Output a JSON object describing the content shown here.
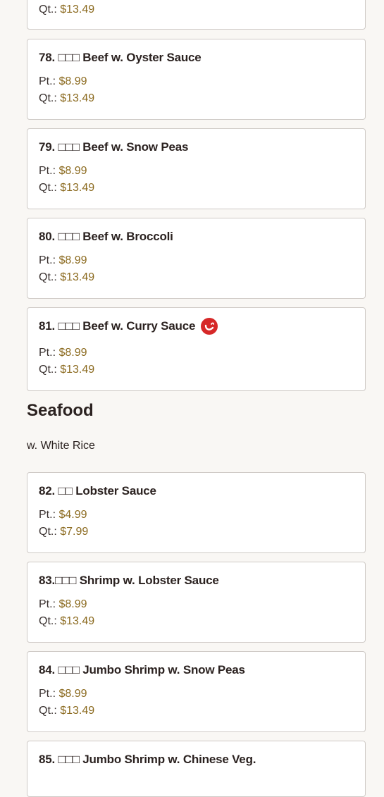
{
  "top_partial": {
    "qt_label": "Qt.:",
    "qt_price": "$13.49"
  },
  "items": [
    {
      "title": "78. □□□ Beef w. Oyster Sauce",
      "pt_label": "Pt.:",
      "pt_price": "$8.99",
      "qt_label": "Qt.:",
      "qt_price": "$13.49"
    },
    {
      "title": "79. □□□ Beef w. Snow Peas",
      "pt_label": "Pt.:",
      "pt_price": "$8.99",
      "qt_label": "Qt.:",
      "qt_price": "$13.49"
    },
    {
      "title": "80. □□□ Beef w. Broccoli",
      "pt_label": "Pt.:",
      "pt_price": "$8.99",
      "qt_label": "Qt.:",
      "qt_price": "$13.49"
    },
    {
      "title": "81. □□□ Beef w. Curry Sauce",
      "pt_label": "Pt.:",
      "pt_price": "$8.99",
      "qt_label": "Qt.:",
      "qt_price": "$13.49",
      "icon": "spicy-icon"
    }
  ],
  "seafood": {
    "title": "Seafood",
    "subtitle": "w. White Rice",
    "items": [
      {
        "title": "82. □□ Lobster Sauce",
        "pt_label": "Pt.:",
        "pt_price": "$4.99",
        "qt_label": "Qt.:",
        "qt_price": "$7.99"
      },
      {
        "title": "83.□□□ Shrimp w. Lobster Sauce",
        "pt_label": "Pt.:",
        "pt_price": "$8.99",
        "qt_label": "Qt.:",
        "qt_price": "$13.49"
      },
      {
        "title": "84. □□□ Jumbo Shrimp w. Snow Peas",
        "pt_label": "Pt.:",
        "pt_price": "$8.99",
        "qt_label": "Qt.:",
        "qt_price": "$13.49"
      },
      {
        "title": "85. □□□ Jumbo Shrimp w. Chinese Veg."
      }
    ]
  },
  "colors": {
    "price": "#8b6a1f",
    "spicy": "#d62828",
    "border": "#cfcac6"
  }
}
